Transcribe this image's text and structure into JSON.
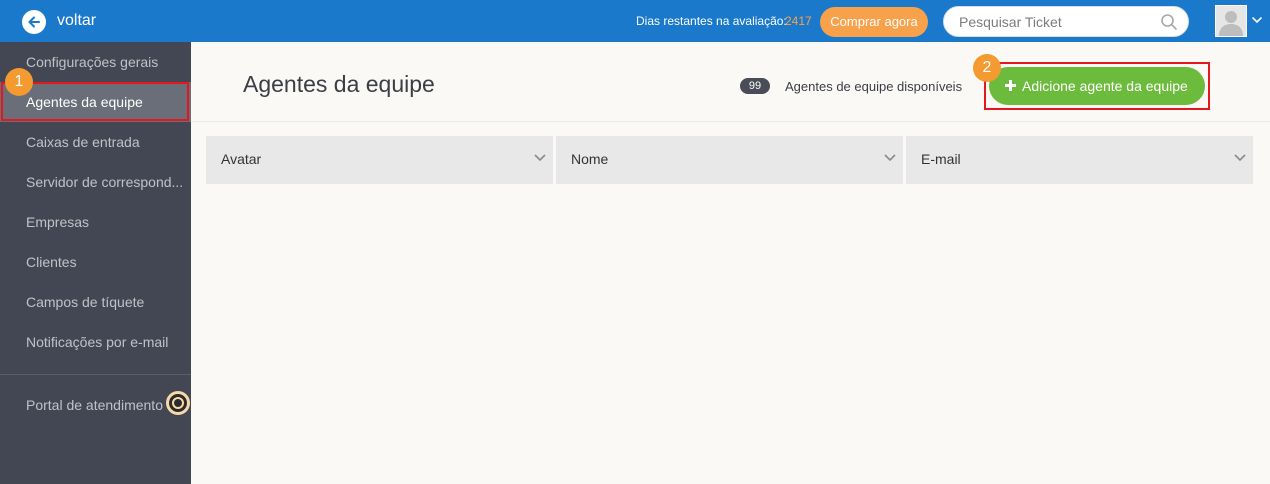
{
  "topbar": {
    "back_label": "voltar",
    "trial_label": "Dias restantes na avaliação:",
    "trial_days": "2417",
    "buy_label": "Comprar agora",
    "search_placeholder": "Pesquisar Ticket"
  },
  "sidebar": {
    "items": [
      {
        "label": "Configurações gerais"
      },
      {
        "label": "Agentes da equipe",
        "active": true
      },
      {
        "label": "Caixas de entrada"
      },
      {
        "label": "Servidor de correspond..."
      },
      {
        "label": "Empresas"
      },
      {
        "label": "Clientes"
      },
      {
        "label": "Campos de tíquete"
      },
      {
        "label": "Notificações por e-mail"
      }
    ],
    "portal_label": "Portal de atendimento"
  },
  "main": {
    "title": "Agentes da equipe",
    "available_count": "99",
    "available_label": "Agentes de equipe disponíveis",
    "add_button_label": "Adicione agente da equipe",
    "columns": [
      {
        "label": "Avatar"
      },
      {
        "label": "Nome"
      },
      {
        "label": "E-mail"
      }
    ]
  },
  "annotations": {
    "step1": "1",
    "step2": "2"
  },
  "colors": {
    "topbar": "#1a79cb",
    "sidebar": "#434754",
    "accent_orange": "#f7a14a",
    "add_green": "#6cbb3c",
    "highlight_red": "#e3171c"
  }
}
